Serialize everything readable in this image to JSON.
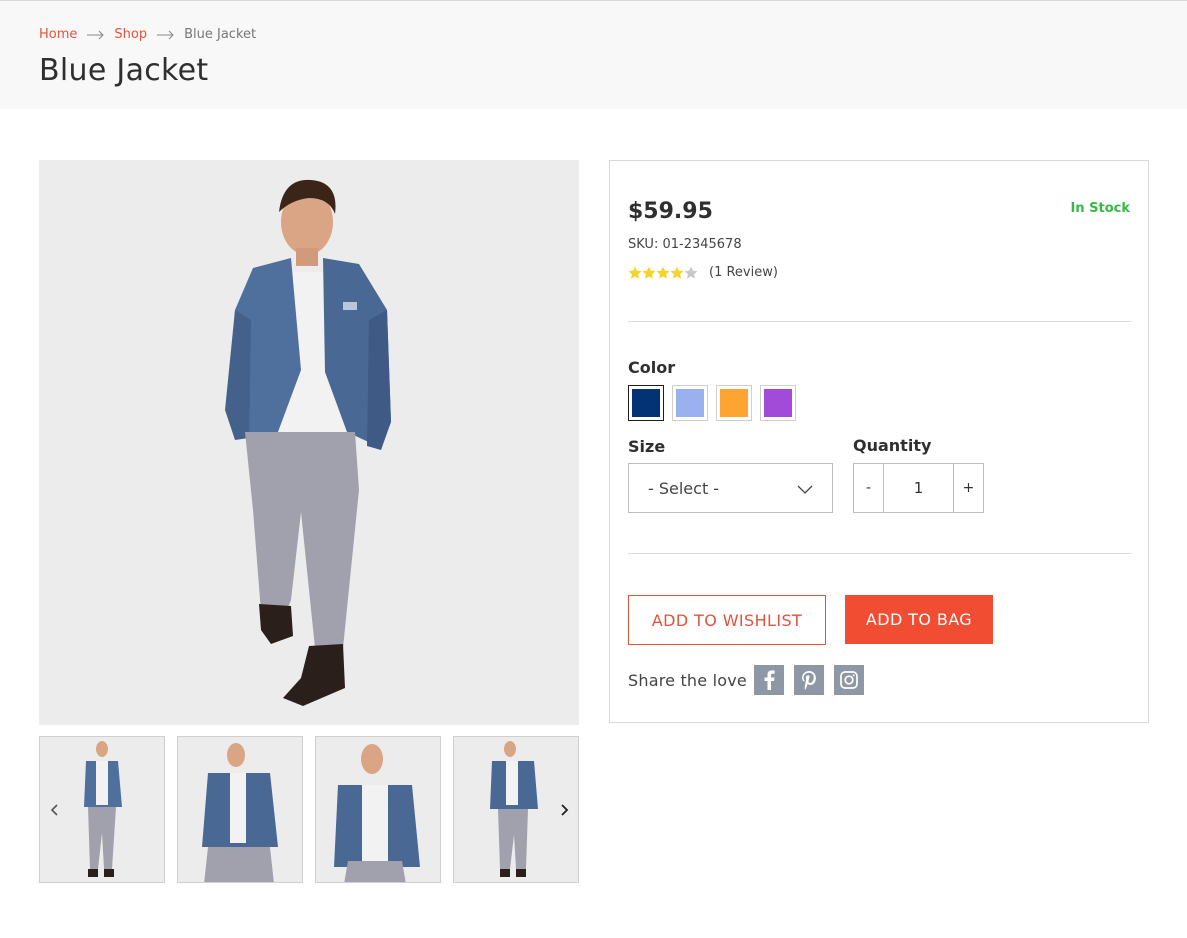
{
  "breadcrumb": {
    "items": [
      {
        "label": "Home"
      },
      {
        "label": "Shop"
      },
      {
        "label": "Blue Jacket"
      }
    ]
  },
  "page_title": "Blue Jacket",
  "product": {
    "price": "$59.95",
    "stock_status": "In Stock",
    "sku": "SKU: 01-2345678",
    "rating": 4,
    "rating_max": 5,
    "review_count": "(1 Review)",
    "color_label": "Color",
    "colors": [
      "#033275",
      "#99b2ef",
      "#fda432",
      "#a24bd8"
    ],
    "selected_color_index": 0,
    "size_label": "Size",
    "size_select": "- Select -",
    "quantity_label": "Quantity",
    "quantity_value": "1",
    "qty_minus": "-",
    "qty_plus": "+",
    "wishlist_button": "ADD TO WISHLIST",
    "bag_button": "ADD TO BAG",
    "share_label": "Share the love",
    "social_icons": [
      "facebook-icon",
      "pinterest-icon",
      "instagram-icon"
    ]
  },
  "colors": {
    "accent": "#e2533b",
    "cta": "#f04d32",
    "stock_green": "#35b84a",
    "star_yellow": "#f6d327"
  }
}
